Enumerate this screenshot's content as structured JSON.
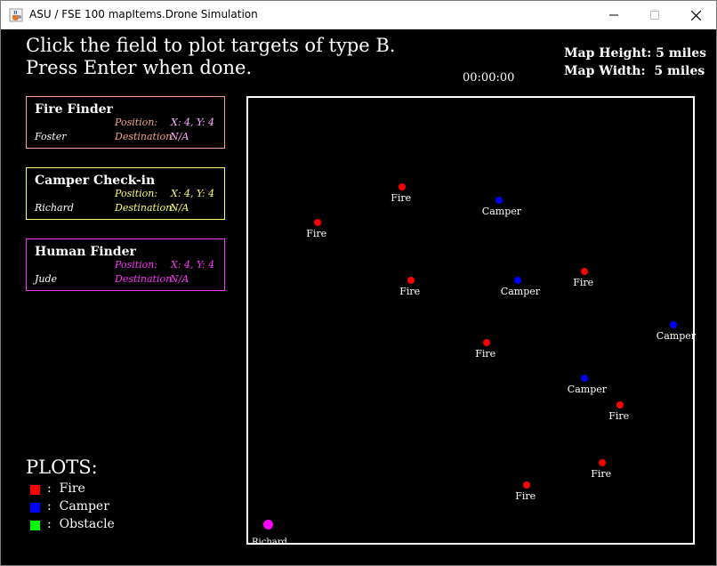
{
  "window": {
    "title": "ASU / FSE 100 mapItems.Drone Simulation",
    "app_icon": "java-cup-icon",
    "controls": [
      "minimize-icon",
      "maximize-icon",
      "close-icon"
    ]
  },
  "header": {
    "instruction_line1": "Click the field to plot targets of type B.",
    "instruction_line2": "Press Enter when done.",
    "timer": "00:00:00",
    "map_height_label": "Map Height:",
    "map_height_value": "5 miles",
    "map_width_label": "Map Width:",
    "map_width_value": "5 miles"
  },
  "drones": [
    {
      "name": "Fire Finder",
      "pilot": "Foster",
      "position_label": "Position:",
      "position_value": "X: 4, Y: 4",
      "destination_label": "Destination:",
      "destination_value": "N/A",
      "color": "#f4a58a",
      "value_color": "#ffb0ff"
    },
    {
      "name": "Camper Check-in",
      "pilot": "Richard",
      "position_label": "Position:",
      "position_value": "X: 4, Y: 4",
      "destination_label": "Destination:",
      "destination_value": "N/A",
      "color": "#ffff66",
      "value_color": "#ffff66"
    },
    {
      "name": "Human Finder",
      "pilot": "Jude",
      "position_label": "Position:",
      "position_value": "X: 4, Y: 4",
      "destination_label": "Destination:",
      "destination_value": "N/A",
      "color": "#ff33ff",
      "value_color": "#ff33ff"
    }
  ],
  "legend": {
    "title": "PLOTS:",
    "items": [
      {
        "label": "Fire",
        "color": "#ff0000"
      },
      {
        "label": "Camper",
        "color": "#0000ff"
      },
      {
        "label": "Obstacle",
        "color": "#00ff00"
      }
    ]
  },
  "field": {
    "drone_marker_color": "#ff00ff",
    "drone_stack_text": "Richard",
    "targets": [
      {
        "type": "Fire",
        "label": "Fire"
      },
      {
        "type": "Camper",
        "label": "Camper"
      },
      {
        "type": "Fire",
        "label": "Fire"
      },
      {
        "type": "Fire",
        "label": "Fire"
      },
      {
        "type": "Camper",
        "label": "Camper"
      },
      {
        "type": "Fire",
        "label": "Fire"
      },
      {
        "type": "Camper",
        "label": "Camper"
      },
      {
        "type": "Fire",
        "label": "Fire"
      },
      {
        "type": "Camper",
        "label": "Camper"
      },
      {
        "type": "Fire",
        "label": "Fire"
      },
      {
        "type": "Fire",
        "label": "Fire"
      },
      {
        "type": "Fire",
        "label": "Fire"
      }
    ]
  }
}
